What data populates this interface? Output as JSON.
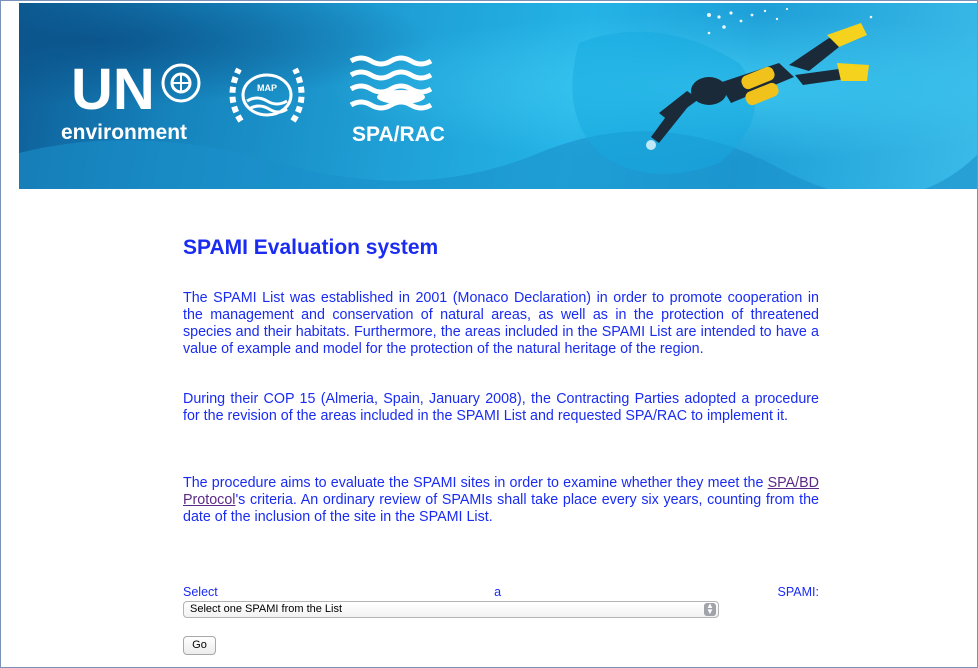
{
  "banner": {
    "un_text": "UN",
    "environment_text": "environment",
    "map_text": "MAP",
    "spa_rac_text": "SPA/RAC"
  },
  "main": {
    "title": "SPAMI Evaluation system",
    "paragraph1": "The SPAMI List was established in 2001 (Monaco Declaration) in order to promote cooperation in the management and conservation of natural areas, as well as in the protection of threatened species and their habitats. Furthermore, the areas included in the SPAMI List are intended to have a value of example and model for the protection of the natural heritage of the region.",
    "paragraph2": "During their COP 15 (Almeria, Spain, January 2008), the Contracting Parties adopted a procedure for the revision of the areas included in the SPAMI List and requested SPA/RAC to implement it.",
    "paragraph3_before": "The procedure aims to evaluate the SPAMI sites in order to examine whether they meet the ",
    "paragraph3_link": "SPA/BD Protocol",
    "paragraph3_after": "'s criteria. An ordinary review of SPAMIs shall take place every six years, counting from the date of the inclusion of the site in the SPAMI List."
  },
  "form": {
    "label_words": [
      "Select",
      "a",
      "SPAMI:"
    ],
    "select_value": "Select one SPAMI from the List",
    "go_label": "Go"
  },
  "colors": {
    "text_blue": "#1a2cf2",
    "link_purple": "#5a2a86",
    "banner_blue": "#1fa0d6"
  }
}
